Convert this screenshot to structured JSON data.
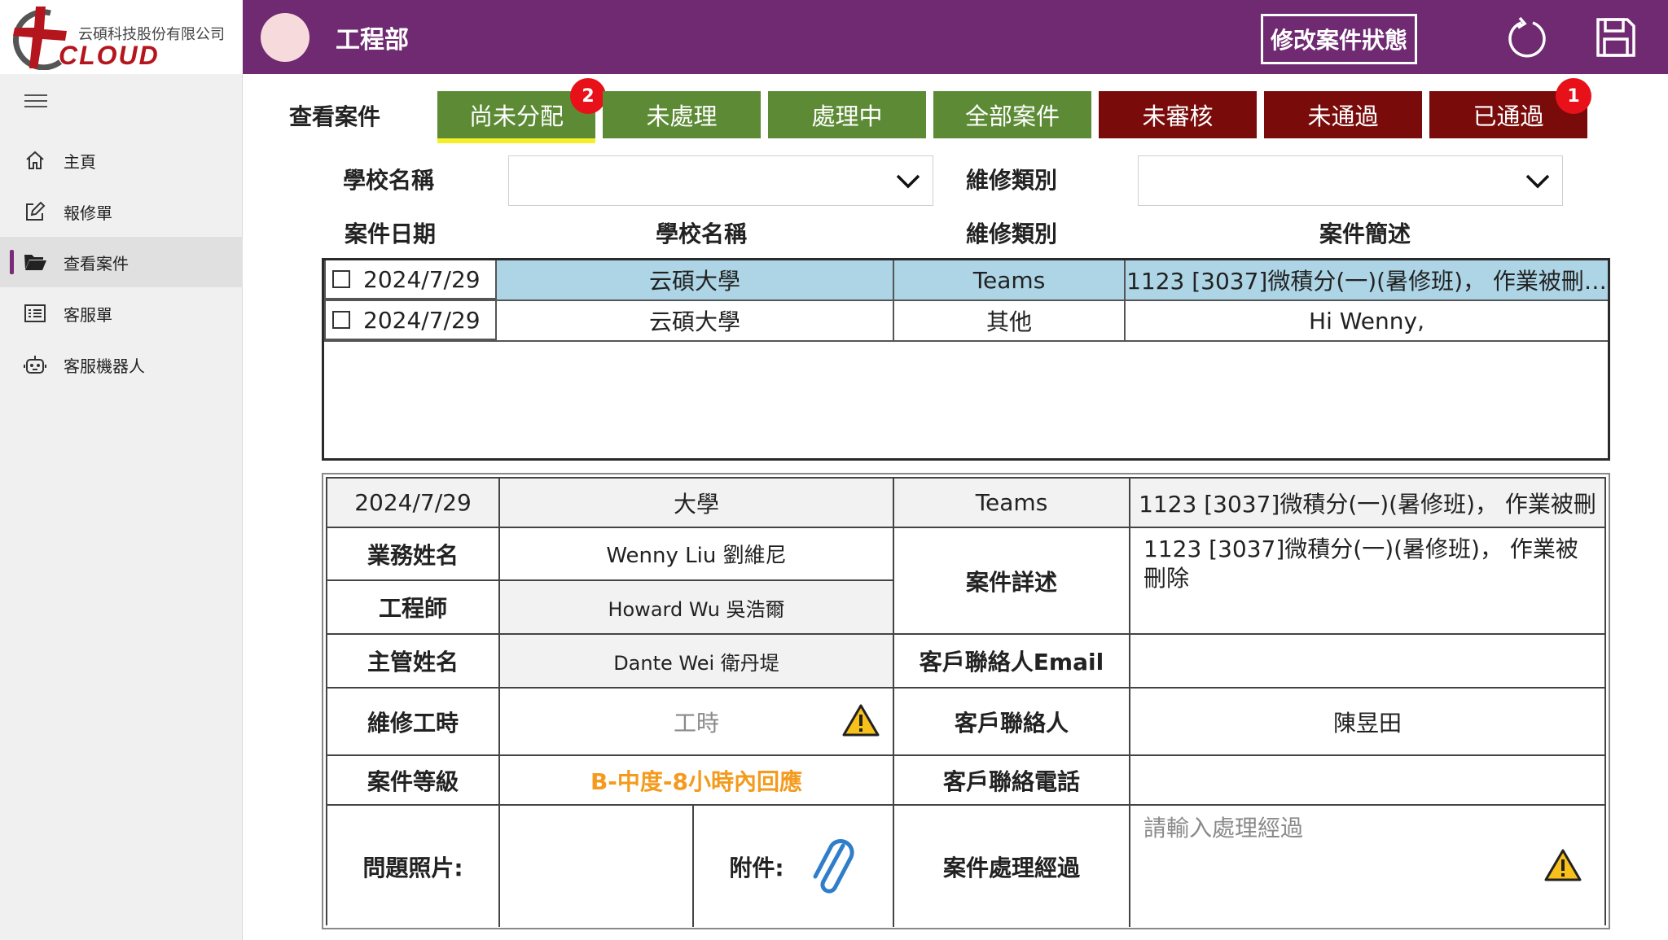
{
  "sidebar": {
    "company_name": "云碩科技股份有限公司",
    "logo_text": "CLOUD",
    "items": [
      {
        "label": "主頁",
        "icon": "home-icon"
      },
      {
        "label": "報修單",
        "icon": "edit-icon"
      },
      {
        "label": "查看案件",
        "icon": "folder-open-icon"
      },
      {
        "label": "客服單",
        "icon": "list-icon"
      },
      {
        "label": "客服機器人",
        "icon": "robot-icon"
      }
    ],
    "active_index": 2
  },
  "header": {
    "title": "工程部",
    "status_button": "修改案件狀態",
    "colors": {
      "bar": "#6f2a71",
      "avatar": "#f7dbdc"
    }
  },
  "tabs": {
    "label": "查看案件",
    "items": [
      {
        "label": "尚未分配",
        "badge": "2",
        "color": "#5d8b35"
      },
      {
        "label": "未處理",
        "color": "#5d8b35"
      },
      {
        "label": "處理中",
        "color": "#5d8b35"
      },
      {
        "label": "全部案件",
        "color": "#5d8b35"
      },
      {
        "label": "未審核",
        "color": "#7a0b0b"
      },
      {
        "label": "未通過",
        "color": "#7a0b0b"
      },
      {
        "label": "已通過",
        "badge": "1",
        "color": "#7a0b0b"
      }
    ],
    "selected_index": 0
  },
  "filters": {
    "school_label": "學校名稱",
    "school_value": "",
    "type_label": "維修類別",
    "type_value": ""
  },
  "case_list": {
    "columns": [
      "案件日期",
      "學校名稱",
      "維修類別",
      "案件簡述"
    ],
    "rows": [
      {
        "date": "2024/7/29",
        "school": "云碩大學",
        "type": "Teams",
        "desc": "1123 [3037]微積分(一)(暑修班)， 作業被刪…"
      },
      {
        "date": "2024/7/29",
        "school": "云碩大學",
        "type": "其他",
        "desc": "Hi Wenny,"
      }
    ]
  },
  "detail": {
    "date": "2024/7/29",
    "school": "大學",
    "type": "Teams",
    "summary": "1123 [3037]微積分(一)(暑修班)， 作業被刪",
    "sales_label": "業務姓名",
    "sales_value": "Wenny Liu 劉維尼",
    "engineer_label": "工程師",
    "engineer_value": "Howard Wu 吳浩爾",
    "manager_label": "主管姓名",
    "manager_value": "Dante Wei 衛丹堤",
    "hours_label": "維修工時",
    "hours_placeholder": "工時",
    "level_label": "案件等級",
    "level_value": "B-中度-8小時內回應",
    "photo_label": "問題照片:",
    "attach_label": "附件:",
    "detail_label": "案件詳述",
    "detail_value": "1123 [3037]微積分(一)(暑修班)， 作業被刪除",
    "email_label": "客戶聯絡人Email",
    "email_value": "",
    "contact_label": "客戶聯絡人",
    "contact_value": "陳昱田",
    "phone_label": "客戶聯絡電話",
    "phone_value": "",
    "process_label": "案件處理經過",
    "process_placeholder": "請輸入處理經過"
  }
}
